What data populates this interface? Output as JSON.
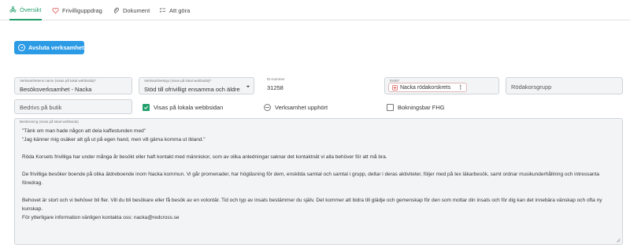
{
  "tabs": [
    {
      "label": "Översikt",
      "icon": "flower-icon",
      "active": true
    },
    {
      "label": "Frivilliguppdrag",
      "icon": "heart-icon",
      "active": false
    },
    {
      "label": "Dokument",
      "icon": "paperclip-icon",
      "active": false
    },
    {
      "label": "Att göra",
      "icon": "checklist-icon",
      "active": false
    }
  ],
  "end_button": {
    "label": "Avsluta verksamhet",
    "icon": "arrow-circle-icon"
  },
  "fields": {
    "name": {
      "label": "Verksamhetens namn (visas på lokal webbsida)*",
      "value": "Besöksverksamhet - Nacka"
    },
    "type": {
      "label": "Verksamhetstyp (visas på lokal webbsida)*",
      "value": "Stöd till ofrivilligt ensamma och äldre"
    },
    "id": {
      "label": "ID-nummer",
      "value": "31258"
    },
    "kretsar": {
      "label": "Krets*",
      "chip": "Nacka rödakorskrets"
    },
    "group": {
      "placeholder": "Rödakorsgrupp"
    },
    "business": {
      "placeholder": "Bedrivs på butik"
    }
  },
  "checks": {
    "show_local": {
      "label": "Visas på lokala webbsidan",
      "checked": true
    },
    "ended": {
      "label": "Verksamhet upphört"
    },
    "bookable": {
      "label": "Bokningsbar FHG",
      "checked": false
    }
  },
  "description": {
    "label": "Beskrivning (visas på lokal webbsida)",
    "lines": [
      "\"Tänk om man hade någon att dela kaffestunden med\"",
      "\"Jag känner mig osäker att gå ut på egen hand, men vill gärna komma ut ibland.\"",
      "",
      "Röda Korsets frivilliga har under många år besökt eller haft kontakt med människor, som av olika anledningar saknar det kontaktnät vi alla behöver för att må bra.",
      "",
      "De frivilliga besöker boende på olika äldreboende inom Nacka kommun. Vi går promenader, har högläsning för dem, enskilda samtal och samtal i grupp, deltar i deras aktiviteter, följer med på tex läkarbesök, samt ordnar musikunderhållning och intressanta",
      "föredrag.",
      "",
      "Behovet är stort och vi behöver bli fler. Vill du bli besökare eller få besök av en volontär. Tid och typ av insats bestämmer du själv. Det kommer att bidra till glädje och gemenskap för den som mottar din insats och för dig kan det innebära vänskap och ofta ny",
      "kunskap.",
      "För ytterligare information vänligen kontakta oss: nacka@redcross.se"
    ]
  },
  "colors": {
    "accent": "#22a06b",
    "button": "#2c9be6",
    "field_bg": "#f3f4f6"
  }
}
